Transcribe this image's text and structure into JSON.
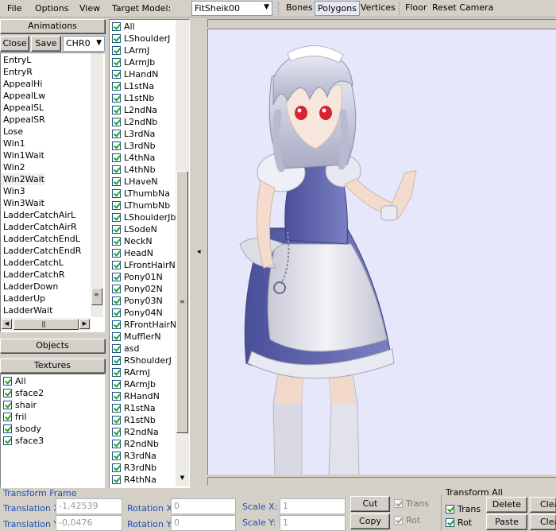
{
  "menu": {
    "file": "File",
    "options": "Options",
    "view": "View",
    "target_model_label": "Target Model:",
    "target_model_value": "FitSheik00",
    "bones": "Bones",
    "polygons": "Polygons",
    "vertices": "Vertices",
    "floor": "Floor",
    "reset_camera": "Reset Camera"
  },
  "animations": {
    "header": "Animations",
    "close": "Close",
    "save": "Save",
    "chr_select": "CHR0",
    "items": [
      "EntryL",
      "EntryR",
      "AppealHi",
      "AppealLw",
      "AppealSL",
      "AppealSR",
      "Lose",
      "Win1",
      "Win1Wait",
      "Win2",
      "Win2Wait",
      "Win3",
      "Win3Wait",
      "LadderCatchAirL",
      "LadderCatchAirR",
      "LadderCatchEndL",
      "LadderCatchEndR",
      "LadderCatchL",
      "LadderCatchR",
      "LadderDown",
      "LadderUp",
      "LadderWait"
    ],
    "selected": "Win2Wait"
  },
  "objects": {
    "header": "Objects"
  },
  "textures": {
    "header": "Textures",
    "items": [
      "All",
      "sface2",
      "shair",
      "fril",
      "sbody",
      "sface3"
    ]
  },
  "bones": {
    "items": [
      "All",
      "LShoulderJ",
      "LArmJ",
      "LArmJb",
      "LHandN",
      "L1stNa",
      "L1stNb",
      "L2ndNa",
      "L2ndNb",
      "L3rdNa",
      "L3rdNb",
      "L4thNa",
      "L4thNb",
      "LHaveN",
      "LThumbNa",
      "LThumbNb",
      "LShoulderJb",
      "LSodeN",
      "NeckN",
      "HeadN",
      "LFrontHairN",
      "Pony01N",
      "Pony02N",
      "Pony03N",
      "Pony04N",
      "RFrontHairN",
      "MufflerN",
      "asd",
      "RShoulderJ",
      "RArmJ",
      "RArmJb",
      "RHandN",
      "R1stNa",
      "R1stNb",
      "R2ndNa",
      "R2ndNb",
      "R3rdNa",
      "R3rdNb",
      "R4thNa"
    ]
  },
  "transform_frame": {
    "title": "Transform Frame",
    "translation_x_label": "Translation X:",
    "translation_x": "-1,42539",
    "translation_y_label": "Translation Y:",
    "translation_y": "-0,0476",
    "rotation_x_label": "Rotation X:",
    "rotation_x": "0",
    "rotation_y_label": "Rotation Y:",
    "rotation_y": "0",
    "scale_x_label": "Scale X:",
    "scale_x": "1",
    "scale_y_label": "Scale Y:",
    "scale_y": "1",
    "cut": "Cut",
    "copy": "Copy",
    "trans": "Trans",
    "rot": "Rot"
  },
  "transform_all": {
    "title": "Transform All",
    "trans": "Trans",
    "rot": "Rot",
    "delete": "Delete",
    "paste": "Paste",
    "clear1": "Clea",
    "clear2": "Clea"
  }
}
